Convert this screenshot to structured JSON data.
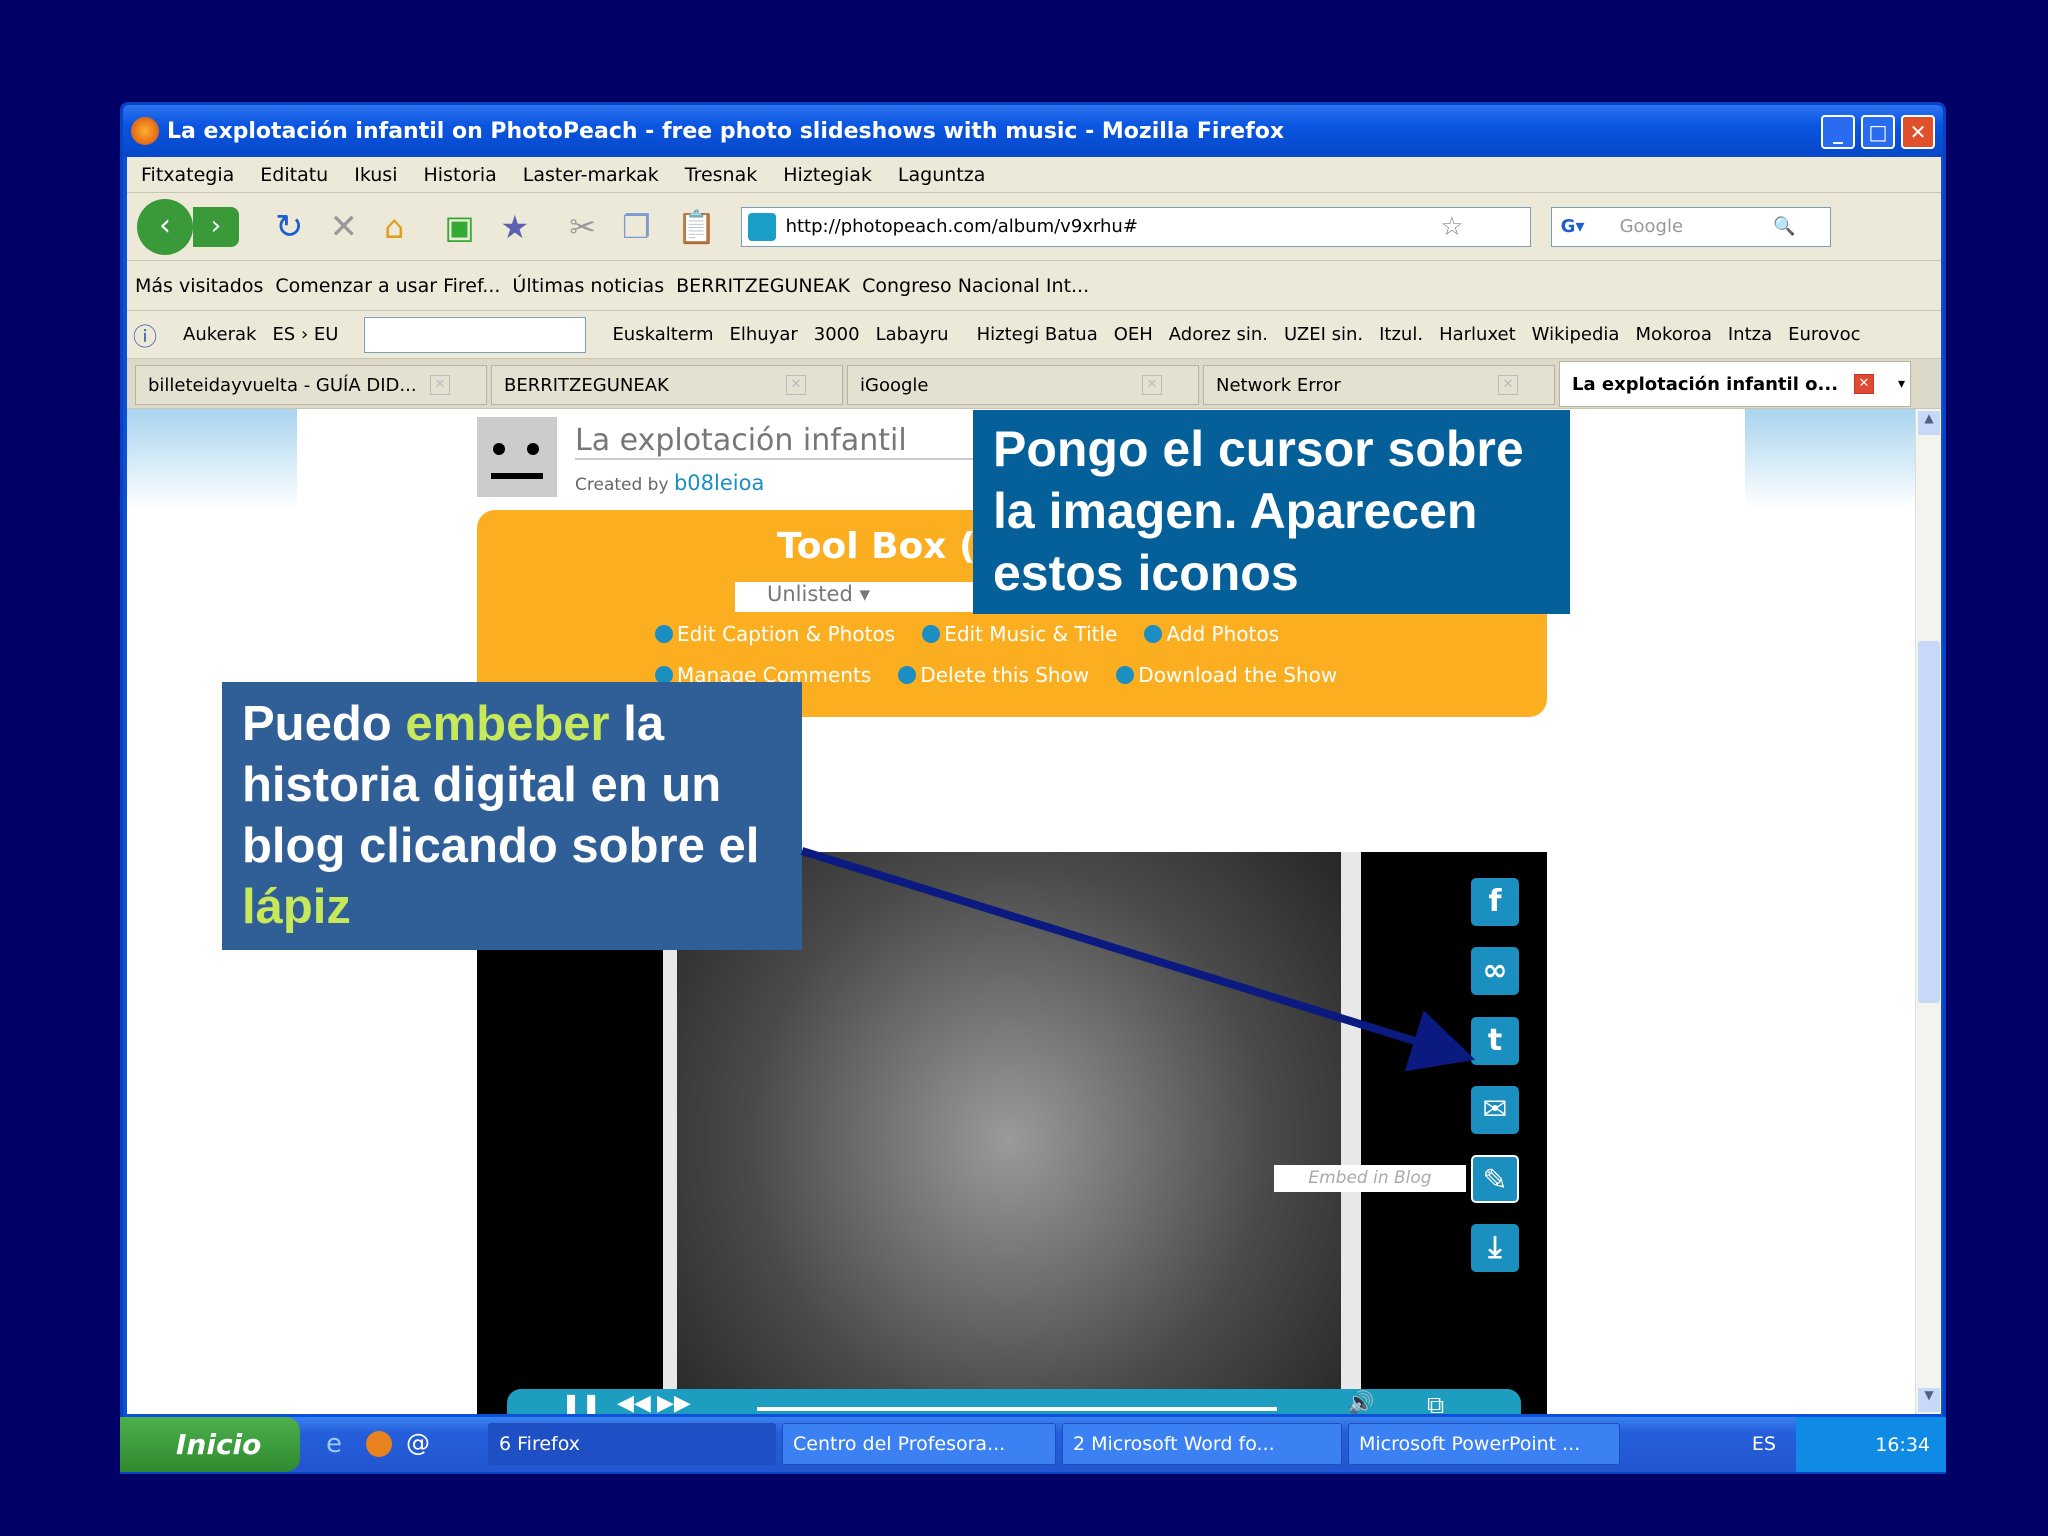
{
  "window": {
    "title": "La explotación infantil on PhotoPeach - free photo slideshows with music - Mozilla Firefox"
  },
  "menu": [
    "Fitxategia",
    "Editatu",
    "Ikusi",
    "Historia",
    "Laster-markak",
    "Tresnak",
    "Hiztegiak",
    "Laguntza"
  ],
  "address": {
    "url": "http://photopeach.com/album/v9xrhu#",
    "search_placeholder": "Google"
  },
  "bookmarks": [
    "Más visitados",
    "Comenzar a usar Firef...",
    "Últimas noticias",
    "BERRITZEGUNEAK",
    "Congreso Nacional Int..."
  ],
  "dict": {
    "options": "Aukerak",
    "lang": "ES › EU",
    "links": [
      "Euskalterm",
      "Elhuyar",
      "3000",
      "Labayru",
      "Hiztegi Batua",
      "OEH",
      "Adorez sin.",
      "UZEI sin.",
      "Itzul.",
      "Harluxet",
      "Wikipedia",
      "Mokoroa",
      "Intza",
      "Eurovoc"
    ]
  },
  "tabs": [
    "billeteidayvuelta - GUÍA DID...",
    "BERRITZEGUNEAK",
    "iGoogle",
    "Network Error",
    "La explotación infantil o..."
  ],
  "page": {
    "title": "La explotación infantil",
    "created_by": "Created by",
    "author": "b08leioa",
    "toolbox": "Tool Box (c",
    "privacy": "Unlisted ▾",
    "actions": [
      "Edit Caption & Photos",
      "Edit Music & Title",
      "Add Photos",
      "Manage Comments",
      "Delete this Show",
      "Download the Show"
    ],
    "embed_tooltip": "Embed in Blog"
  },
  "callouts": {
    "top": "Pongo el cursor sobre la imagen. Aparecen estos iconos",
    "left_1": "Puedo ",
    "left_hl1": "embeber",
    "left_2": " la historia digital en un blog clicando  sobre el ",
    "left_hl2": "lápiz"
  },
  "taskbar": {
    "start": "Inicio",
    "items": [
      "6 Firefox",
      "Centro del Profesora...",
      "2 Microsoft Word fo...",
      "Microsoft PowerPoint ..."
    ],
    "lang": "ES",
    "time": "16:34"
  }
}
